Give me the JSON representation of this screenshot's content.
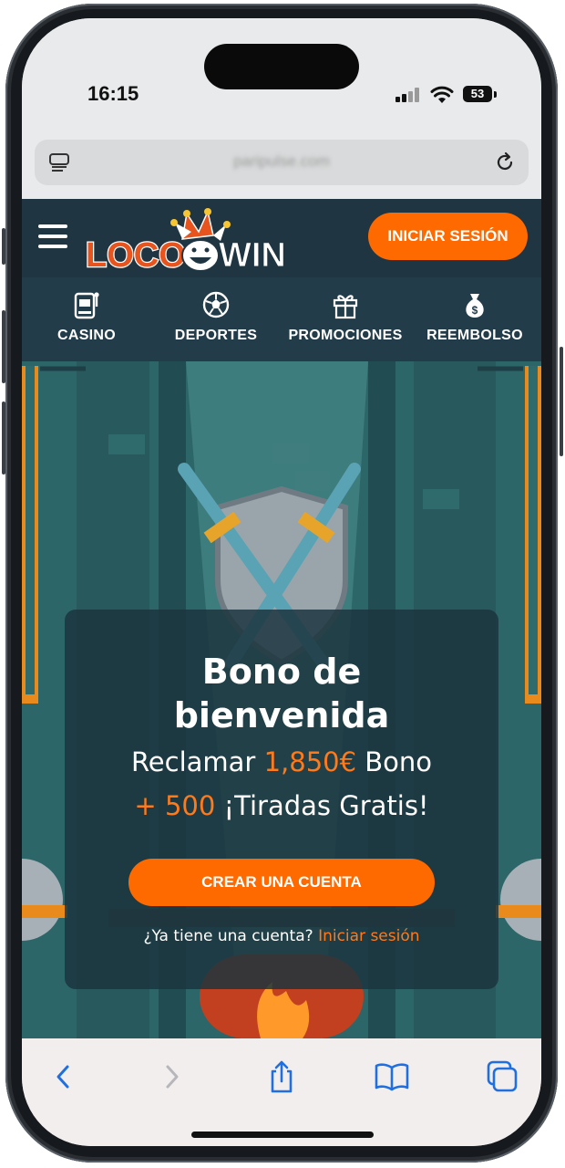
{
  "status_bar": {
    "time": "16:15",
    "battery": "53"
  },
  "browser": {
    "url": "paripulse.com"
  },
  "site": {
    "logo_text_left": "LOCO",
    "logo_text_right": "WIN",
    "login_label": "INICIAR SESIÓN",
    "nav": [
      {
        "label": "CASINO",
        "icon": "slot-machine-icon"
      },
      {
        "label": "DEPORTES",
        "icon": "soccer-ball-icon"
      },
      {
        "label": "PROMOCIONES",
        "icon": "gift-icon"
      },
      {
        "label": "REEMBOLSO",
        "icon": "money-bag-icon"
      }
    ]
  },
  "hero": {
    "title_line1": "Bono de",
    "title_line2": "bienvenida",
    "claim_prefix": "Reclamar ",
    "claim_amount": "1,850€",
    "claim_suffix": " Bono",
    "spins_amount": "+ 500",
    "spins_suffix": " ¡Tiradas Gratis!",
    "cta_label": "CREAR UNA CUENTA",
    "have_account": "¿Ya tiene una cuenta?",
    "login_link": "Iniciar sesión"
  },
  "colors": {
    "accent": "#ff6a00",
    "header_bg": "#1f3542",
    "nav_bg": "#223c4a",
    "hero_bg": "#2e6a6b"
  }
}
